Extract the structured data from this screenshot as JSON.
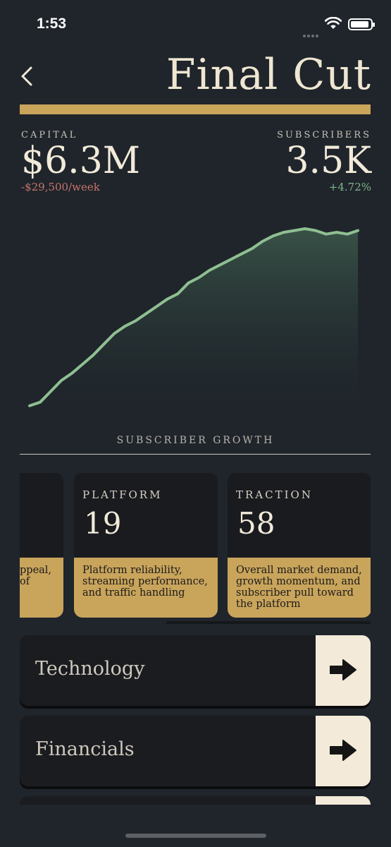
{
  "status_bar": {
    "time": "1:53"
  },
  "header": {
    "title": "Final Cut"
  },
  "stats": {
    "capital": {
      "label": "CAPITAL",
      "value": "$6.3M",
      "change": "-$29,500/week"
    },
    "subscribers": {
      "label": "SUBSCRIBERS",
      "value": "3.5K",
      "change": "+4.72%"
    }
  },
  "chart_data": {
    "type": "area",
    "title": "SUBSCRIBER GROWTH",
    "xlabel": "",
    "ylabel": "",
    "grid": false,
    "line_color": "#8fbf92",
    "values": [
      2,
      4,
      10,
      16,
      20,
      25,
      30,
      36,
      42,
      46,
      49,
      53,
      57,
      61,
      64,
      70,
      73,
      77,
      80,
      83,
      86,
      89,
      93,
      96,
      98,
      99,
      100,
      99,
      97,
      98,
      97,
      99
    ]
  },
  "metric_cards": [
    {
      "label": "",
      "value": "",
      "description": "ppeal,\nof"
    },
    {
      "label": "PLATFORM",
      "value": "19",
      "description": "Platform reliability, streaming performance, and traffic handling"
    },
    {
      "label": "TRACTION",
      "value": "58",
      "description": "Overall market demand, growth momentum, and subscriber pull toward the platform"
    }
  ],
  "sections": [
    {
      "label": "Technology",
      "icon": "arrow-right-icon"
    },
    {
      "label": "Financials",
      "icon": "arrow-right-icon"
    },
    {
      "label": "",
      "icon": "arrow-right-icon"
    }
  ],
  "colors": {
    "accent_gold": "#c9a45b",
    "background": "#1f252b",
    "positive": "#7fb48a",
    "negative": "#c7736b"
  }
}
